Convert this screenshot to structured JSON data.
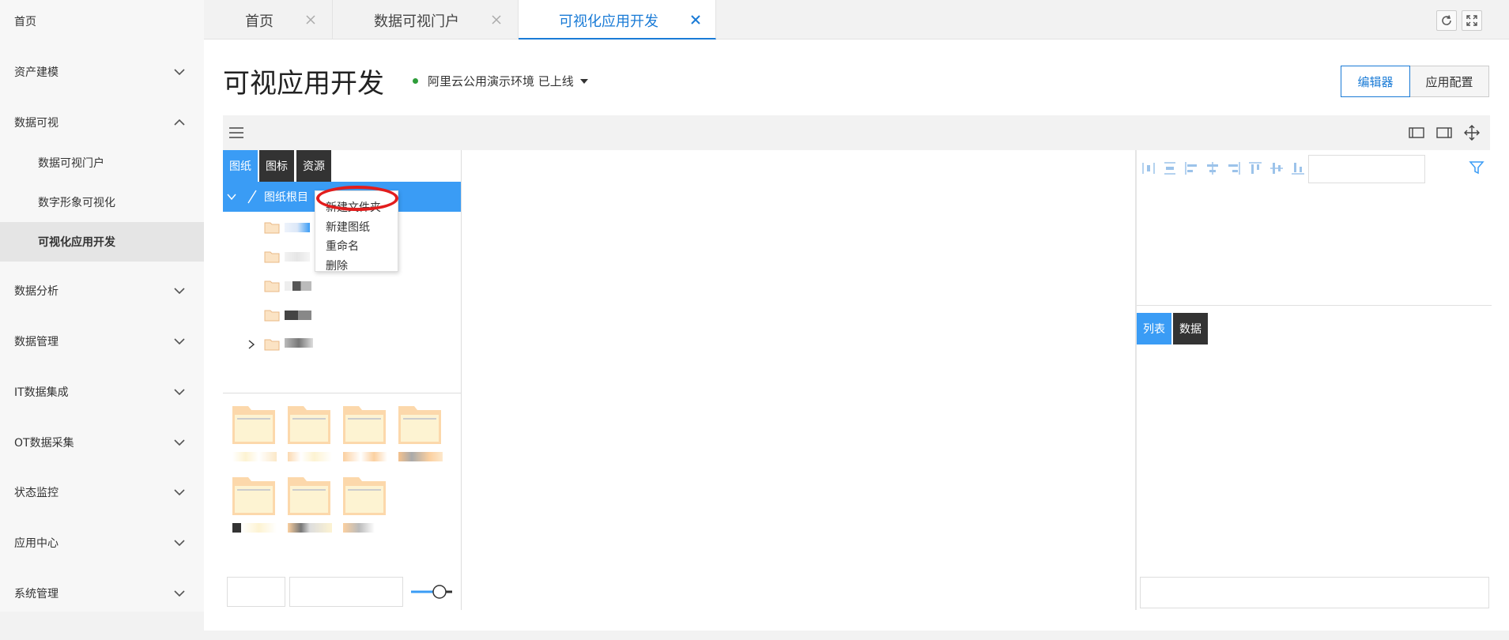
{
  "sidebar": {
    "home": "首页",
    "items": [
      {
        "label": "资产建模",
        "expanded": false
      },
      {
        "label": "数据可视",
        "expanded": true
      },
      {
        "label": "数据分析",
        "expanded": false
      },
      {
        "label": "数据管理",
        "expanded": false
      },
      {
        "label": "IT数据集成",
        "expanded": false
      },
      {
        "label": "OT数据采集",
        "expanded": false
      },
      {
        "label": "状态监控",
        "expanded": false
      },
      {
        "label": "应用中心",
        "expanded": false
      },
      {
        "label": "系统管理",
        "expanded": false
      }
    ],
    "subitems": [
      {
        "label": "数据可视门户",
        "active": false
      },
      {
        "label": "数字形象可视化",
        "active": false
      },
      {
        "label": "可视化应用开发",
        "active": true
      }
    ]
  },
  "tabs": [
    {
      "label": "首页",
      "active": false
    },
    {
      "label": "数据可视门户",
      "active": false
    },
    {
      "label": "可视化应用开发",
      "active": true
    }
  ],
  "header": {
    "title": "可视应用开发",
    "environment": "阿里云公用演示环境 已上线",
    "environment_status_color": "#2e9d3a",
    "editor_button": "编辑器",
    "config_button": "应用配置"
  },
  "left_panel": {
    "tabs": [
      "图纸",
      "图标",
      "资源"
    ],
    "active_tab": "图纸",
    "tree_root": "图纸根目"
  },
  "context_menu": {
    "items": [
      "新建文件夹",
      "新建图纸",
      "重命名",
      "删除"
    ],
    "highlighted": "新建文件夹"
  },
  "right_panel": {
    "tabs": [
      "列表",
      "数据"
    ],
    "active_tab": "列表"
  },
  "colors": {
    "accent": "#1a7bd6",
    "tab_active": "#3a9cf5",
    "highlight_ring": "#e21d1d"
  }
}
